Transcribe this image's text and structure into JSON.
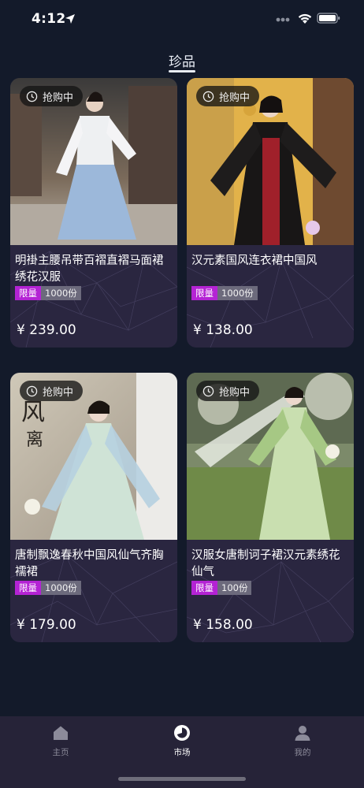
{
  "status_bar": {
    "time": "4:12"
  },
  "header": {
    "title": "珍品"
  },
  "products": [
    {
      "badge": "抢购中",
      "name": "明褂主腰吊带百褶直褶马面裙绣花汉服",
      "limit_tag": "限量",
      "quantity": "1000份",
      "price": "¥ 239.00"
    },
    {
      "badge": "抢购中",
      "name": "汉元素国风连衣裙中国风",
      "limit_tag": "限量",
      "quantity": "1000份",
      "price": "¥ 138.00"
    },
    {
      "badge": "抢购中",
      "name": "唐制飘逸春秋中国风仙气齐胸襦裙",
      "limit_tag": "限量",
      "quantity": "1000份",
      "price": "¥ 179.00"
    },
    {
      "badge": "抢购中",
      "name": "汉服女唐制诃子裙汉元素绣花仙气",
      "limit_tag": "限量",
      "quantity": "100份",
      "price": "¥ 158.00"
    }
  ],
  "tab_bar": {
    "tabs": [
      {
        "label": "主页",
        "icon": "home-icon"
      },
      {
        "label": "市场",
        "icon": "market-pie-icon",
        "active": true
      },
      {
        "label": "我的",
        "icon": "person-icon"
      }
    ]
  },
  "colors": {
    "background": "#131a2a",
    "card": "#2a2640",
    "limit_tag": "#b423d4",
    "tabbar": "#262338"
  }
}
